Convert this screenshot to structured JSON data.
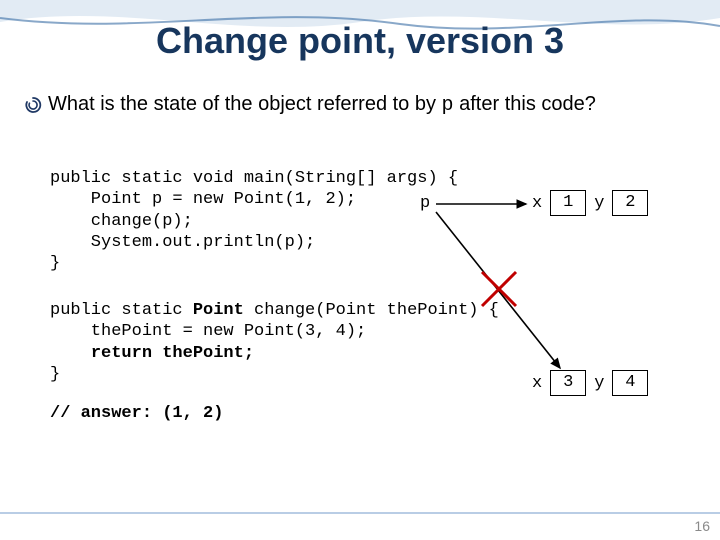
{
  "title": "Change point, version 3",
  "question_prefix": "What is the state of the object referred to by ",
  "question_code": "p",
  "question_suffix": " after this code?",
  "code_block_1": [
    "public static void main(String[] args) {",
    "    Point p = new Point(1, 2);",
    "    change(p);",
    "    System.out.println(p);",
    "}"
  ],
  "code_block_2_parts": {
    "sig_prefix": "public static ",
    "sig_return": "Point",
    "sig_rest": " change(Point thePoint) {",
    "line2": "    thePoint = new Point(3, 4);",
    "line3_prefix": "    ",
    "line3_bold": "return thePoint;",
    "line4": "}"
  },
  "answer": "// answer: (1, 2)",
  "p_pointer_label": "p",
  "box1": {
    "xlabel": "x",
    "xval": "1",
    "ylabel": "y",
    "yval": "2"
  },
  "box2": {
    "xlabel": "x",
    "xval": "3",
    "ylabel": "y",
    "yval": "4"
  },
  "page_number": "16"
}
